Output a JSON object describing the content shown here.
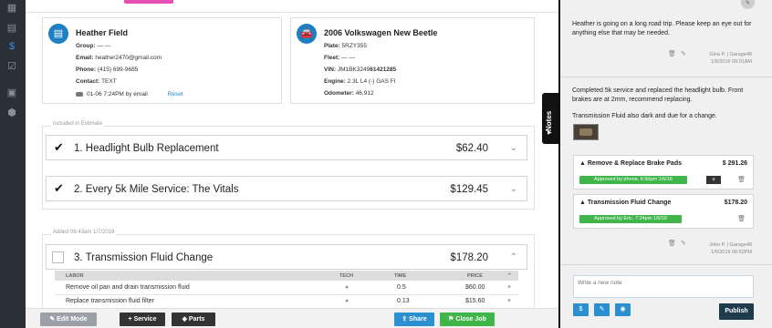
{
  "sidebar": {
    "icons": [
      "calendar-icon",
      "dollar-icon",
      "checklist-icon",
      "id-card-icon",
      "box-icon"
    ]
  },
  "customer": {
    "name": "Heather Field",
    "group_label": "Group:",
    "group_value": "— —",
    "email_label": "Email:",
    "email_value": "heather2470@gmail.com",
    "phone_label": "Phone:",
    "phone_value": "(415) 699-9685",
    "contact_label": "Contact:",
    "contact_value": "TEXT",
    "message_status": "01-06 7:24PM by email",
    "reset": "Reset"
  },
  "vehicle": {
    "name": "2006 Volkswagen New Beetle",
    "plate_label": "Plate:",
    "plate_value": "5RZY355",
    "fleet_label": "Fleet:",
    "fleet_value": "— —",
    "vin_label": "VIN:",
    "vin_prefix": "JM1BK3249",
    "vin_suffix": "61421285",
    "engine_label": "Engine:",
    "engine_value": "2.3L L4 (-) GAS FI",
    "odometer_label": "Odometer:",
    "odometer_value": "46,912"
  },
  "estimate": {
    "included_label": "Included in Estimate",
    "added_label": "Added 08:43am 1/7/2016",
    "jobs": [
      {
        "title": "1.  Headlight Bulb Replacement",
        "price": "$62.40"
      },
      {
        "title": "2.  Every 5k Mile Service: The Vitals",
        "price": "$129.45"
      },
      {
        "title": "3.  Transmission Fluid Change",
        "price": "$178.20"
      }
    ],
    "labor_headers": {
      "labor": "LABOR",
      "tech": "TECH",
      "time": "TIME",
      "price": "PRICE"
    },
    "labor_rows": [
      {
        "desc": "Remove oil pan and drain transmission fluid",
        "time": "0.5",
        "price": "$60.00"
      },
      {
        "desc": "Replace transmission fluid filter",
        "time": "0.13",
        "price": "$15.60"
      }
    ]
  },
  "toolbar": {
    "edit_mode": "Edit Mode",
    "service": "Service",
    "parts": "Parts",
    "share": "Share",
    "close_job": "Close Job"
  },
  "notes": {
    "tab_label": "Notes",
    "note1": {
      "text": "Heather is going on a long road trip. Please keep an eye out for anything else that may be needed.",
      "author": "Gina P. | Garage48",
      "time": "1/6/2016 09:01AM"
    },
    "note2": {
      "text1": "Completed 5k service and replaced the headlight bulb. Front brakes are at 2mm, recommend replacing.",
      "text2": "Transmission Fluid also dark and due for a change.",
      "author": "John P. | Garage48",
      "time": "1/6/2016 06:52PM"
    },
    "items": [
      {
        "title": "Remove & Replace Brake Pads",
        "price": "$ 291.26",
        "approval": "Approved by phone, 6:56pm 1/6/16"
      },
      {
        "title": "Transmission Fluid Change",
        "price": "$178.20",
        "approval": "Approved by Eric, 7:24pm 1/6/16"
      }
    ],
    "compose_placeholder": "Write a new note",
    "publish": "Publish"
  }
}
